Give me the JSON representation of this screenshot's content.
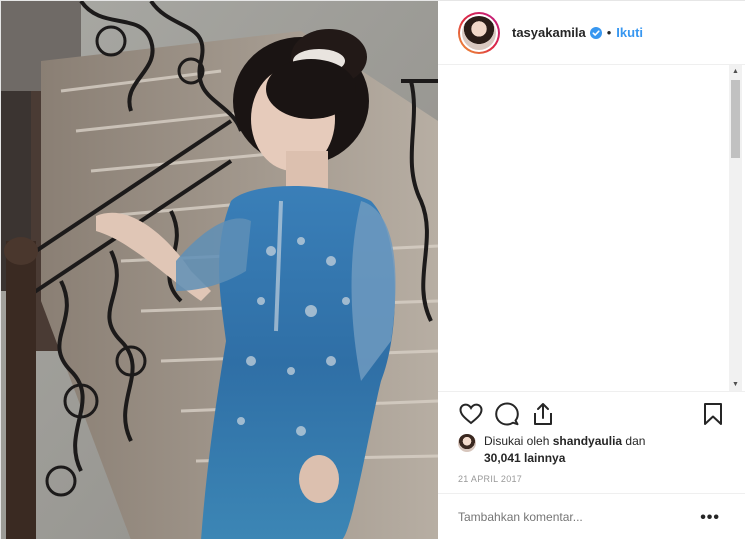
{
  "post": {
    "username": "tasyakamila",
    "separator": "•",
    "follow_label": "Ikuti",
    "likes_prefix": "Disukai oleh",
    "liked_by": "shandyaulia",
    "likes_mid": "dan",
    "likes_count": "30,041 lainnya",
    "date": "21 APRIL 2017",
    "comment_placeholder": "Tambahkan komentar...",
    "more_label": "•••"
  },
  "icons": {
    "verified": "verified-badge-icon",
    "like": "heart-icon",
    "comment": "comment-bubble-icon",
    "share": "share-icon",
    "save": "bookmark-icon",
    "more": "more-options-icon"
  },
  "colors": {
    "accent": "#3897f0",
    "text": "#262626",
    "muted": "#999999",
    "border": "#efefef"
  }
}
